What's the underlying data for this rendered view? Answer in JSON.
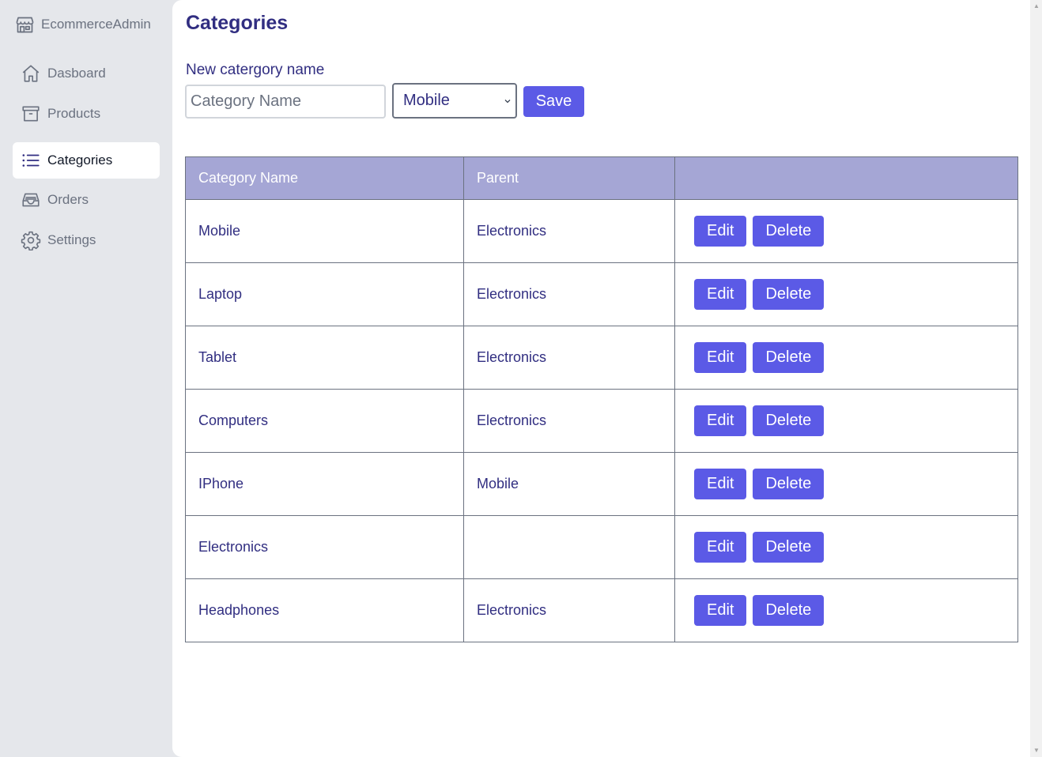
{
  "brand": {
    "name": "EcommerceAdmin",
    "icon": "store-icon"
  },
  "sidebar": {
    "items": [
      {
        "label": "Dasboard",
        "icon": "home-icon",
        "active": false
      },
      {
        "label": "Products",
        "icon": "archive-icon",
        "active": false
      },
      {
        "label": "Categories",
        "icon": "list-icon",
        "active": true
      },
      {
        "label": "Orders",
        "icon": "inbox-icon",
        "active": false
      },
      {
        "label": "Settings",
        "icon": "gear-icon",
        "active": false
      }
    ]
  },
  "page": {
    "title": "Categories"
  },
  "form": {
    "label": "New catergory name",
    "name_placeholder": "Category Name",
    "name_value": "",
    "parent_selected": "Mobile",
    "save_label": "Save"
  },
  "table": {
    "headers": [
      "Category Name",
      "Parent",
      ""
    ],
    "edit_label": "Edit",
    "delete_label": "Delete",
    "rows": [
      {
        "name": "Mobile",
        "parent": "Electronics"
      },
      {
        "name": "Laptop",
        "parent": "Electronics"
      },
      {
        "name": "Tablet",
        "parent": "Electronics"
      },
      {
        "name": "Computers",
        "parent": "Electronics"
      },
      {
        "name": "IPhone",
        "parent": "Mobile"
      },
      {
        "name": "Electronics",
        "parent": ""
      },
      {
        "name": "Headphones",
        "parent": "Electronics"
      }
    ]
  },
  "colors": {
    "primary": "#5b5ae6",
    "text_primary": "#312e81",
    "table_header_bg": "#a5a6d5",
    "sidebar_bg": "#e5e7eb"
  }
}
